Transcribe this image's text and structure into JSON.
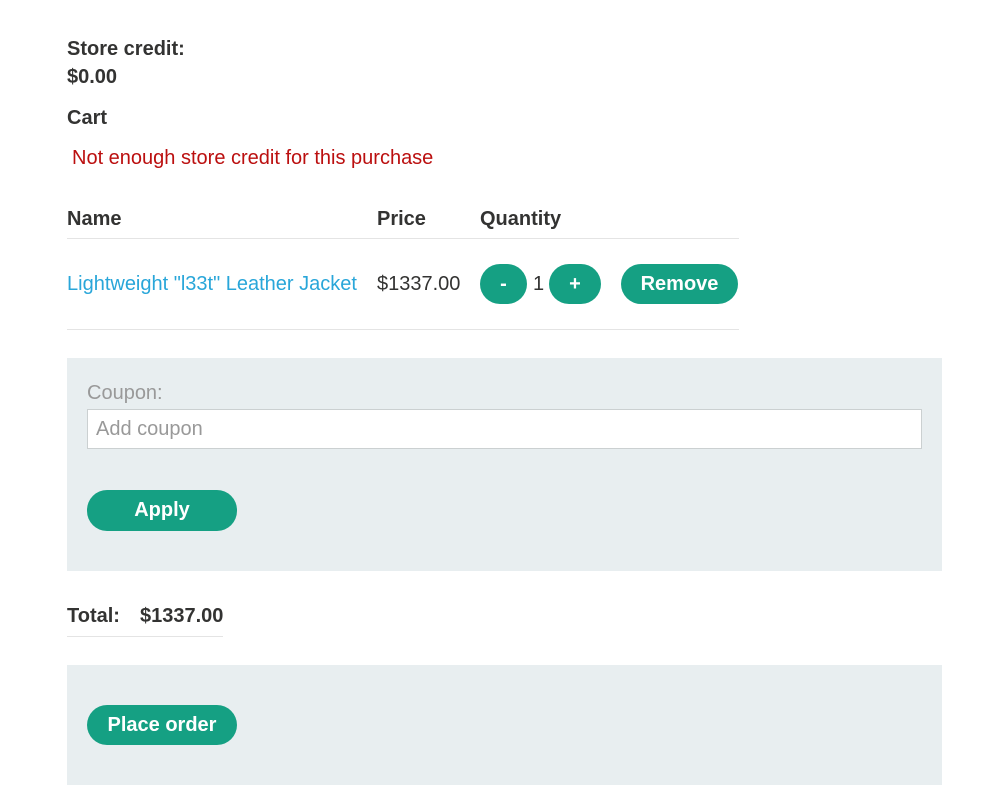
{
  "store_credit": {
    "label": "Store credit:",
    "value": "$0.00"
  },
  "cart": {
    "heading": "Cart",
    "error_message": "Not enough store credit for this purchase",
    "columns": [
      "Name",
      "Price",
      "Quantity"
    ],
    "items": [
      {
        "name": "Lightweight \"l33t\" Leather Jacket",
        "price": "$1337.00",
        "quantity": "1",
        "decrement_label": "-",
        "increment_label": "+",
        "remove_label": "Remove"
      }
    ]
  },
  "coupon": {
    "label": "Coupon:",
    "placeholder": "Add coupon",
    "value": "",
    "apply_label": "Apply"
  },
  "total": {
    "label": "Total:",
    "value": "$1337.00"
  },
  "order": {
    "place_order_label": "Place order"
  },
  "colors": {
    "accent": "#15a083",
    "link": "#29a6d9",
    "error": "#bb0f0f",
    "panel_bg": "#e8eef0",
    "text": "#333332"
  }
}
